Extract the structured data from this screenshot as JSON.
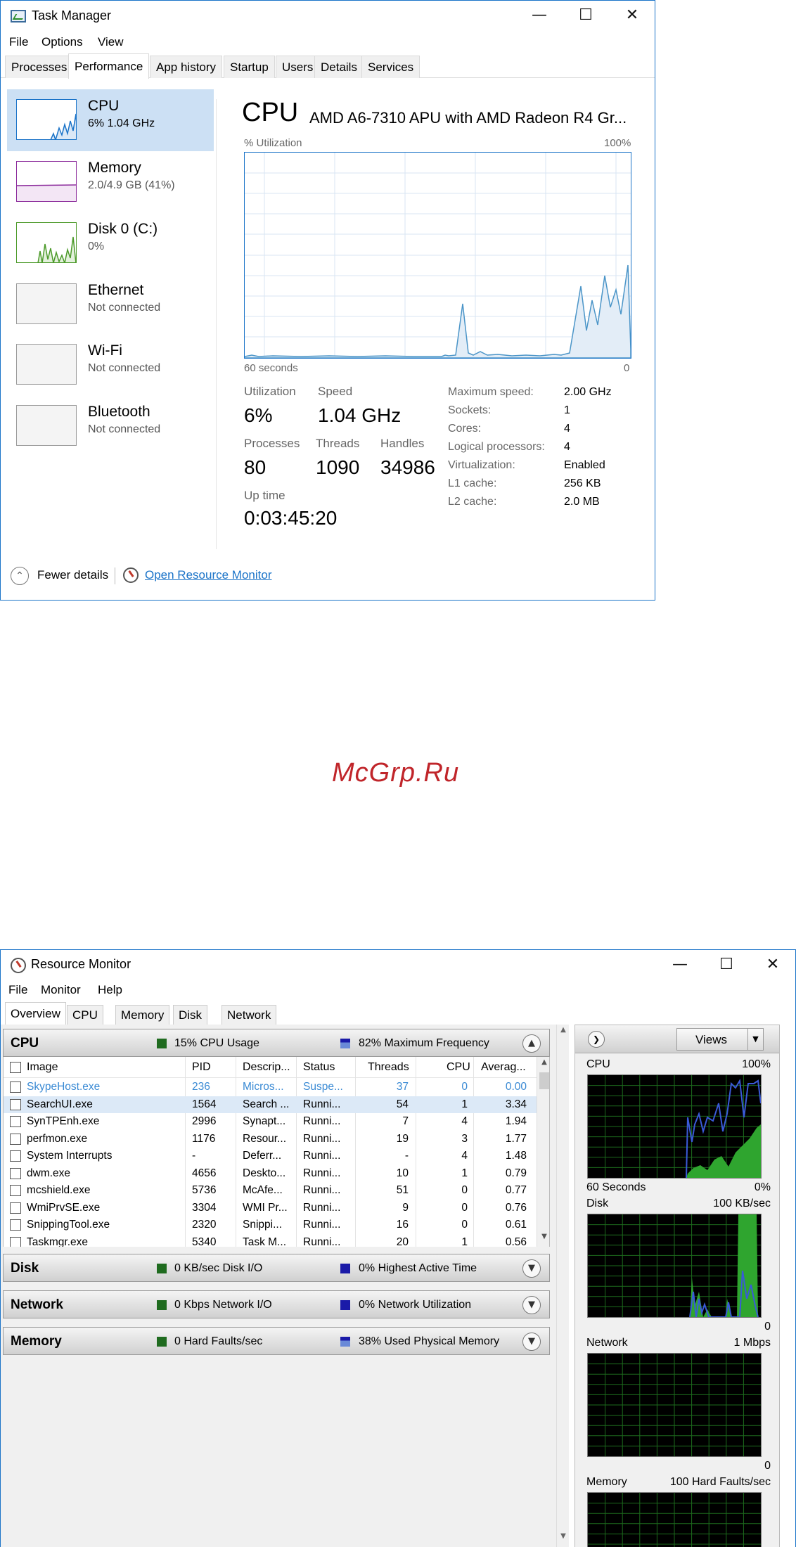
{
  "task_manager": {
    "title": "Task Manager",
    "window_controls": {
      "minimize": "—",
      "maximize": "☐",
      "close": "✕"
    },
    "menu": [
      "File",
      "Options",
      "View"
    ],
    "tabs": [
      "Processes",
      "Performance",
      "App history",
      "Startup",
      "Users",
      "Details",
      "Services"
    ],
    "active_tab": "Performance",
    "sidebar": [
      {
        "name": "CPU",
        "sub": "6%  1.04 GHz",
        "color": "#1a73c8"
      },
      {
        "name": "Memory",
        "sub": "2.0/4.9 GB (41%)",
        "color": "#8b2a9b"
      },
      {
        "name": "Disk 0 (C:)",
        "sub": "0%",
        "color": "#4c9a2a"
      },
      {
        "name": "Ethernet",
        "sub": "Not connected",
        "color": "#999999"
      },
      {
        "name": "Wi-Fi",
        "sub": "Not connected",
        "color": "#999999"
      },
      {
        "name": "Bluetooth",
        "sub": "Not connected",
        "color": "#999999"
      }
    ],
    "cpu": {
      "header": "CPU",
      "model": "AMD A6-7310 APU with AMD Radeon R4 Gr...",
      "util_label": "% Utilization",
      "util_max": "100%",
      "graph_left": "60 seconds",
      "graph_right": "0",
      "utilization_label": "Utilization",
      "utilization": "6%",
      "speed_label": "Speed",
      "speed": "1.04 GHz",
      "processes_label": "Processes",
      "processes": "80",
      "threads_label": "Threads",
      "threads": "1090",
      "handles_label": "Handles",
      "handles": "34986",
      "uptime_label": "Up time",
      "uptime": "0:03:45:20",
      "specs": [
        {
          "label": "Maximum speed:",
          "value": "2.00 GHz"
        },
        {
          "label": "Sockets:",
          "value": "1"
        },
        {
          "label": "Cores:",
          "value": "4"
        },
        {
          "label": "Logical processors:",
          "value": "4"
        },
        {
          "label": "Virtualization:",
          "value": "Enabled"
        },
        {
          "label": "L1 cache:",
          "value": "256 KB"
        },
        {
          "label": "L2 cache:",
          "value": "2.0 MB"
        }
      ]
    },
    "footer": {
      "fewer": "Fewer details",
      "open_rm": "Open Resource Monitor"
    }
  },
  "watermark": "McGrp.Ru",
  "resource_monitor": {
    "title": "Resource Monitor",
    "window_controls": {
      "minimize": "—",
      "maximize": "☐",
      "close": "✕"
    },
    "menu": [
      "File",
      "Monitor",
      "Help"
    ],
    "tabs": [
      "Overview",
      "CPU",
      "Memory",
      "Disk",
      "Network"
    ],
    "active_tab": "Overview",
    "sections": {
      "cpu": {
        "name": "CPU",
        "stat1": "15% CPU Usage",
        "stat2": "82% Maximum Frequency"
      },
      "disk": {
        "name": "Disk",
        "stat1": "0 KB/sec Disk I/O",
        "stat2": "0% Highest Active Time"
      },
      "network": {
        "name": "Network",
        "stat1": "0 Kbps Network I/O",
        "stat2": "0% Network Utilization"
      },
      "memory": {
        "name": "Memory",
        "stat1": "0 Hard Faults/sec",
        "stat2": "38% Used Physical Memory"
      }
    },
    "colors": {
      "green": "#1f6b1f",
      "blue": "#1a1aa8"
    },
    "columns": [
      "Image",
      "PID",
      "Descrip...",
      "Status",
      "Threads",
      "CPU",
      "Averag..."
    ],
    "rows": [
      {
        "image": "SkypeHost.exe",
        "pid": "236",
        "desc": "Micros...",
        "status": "Suspe...",
        "threads": "37",
        "cpu": "0",
        "avg": "0.00"
      },
      {
        "image": "SearchUI.exe",
        "pid": "1564",
        "desc": "Search ...",
        "status": "Runni...",
        "threads": "54",
        "cpu": "1",
        "avg": "3.34"
      },
      {
        "image": "SynTPEnh.exe",
        "pid": "2996",
        "desc": "Synapt...",
        "status": "Runni...",
        "threads": "7",
        "cpu": "4",
        "avg": "1.94"
      },
      {
        "image": "perfmon.exe",
        "pid": "1176",
        "desc": "Resour...",
        "status": "Runni...",
        "threads": "19",
        "cpu": "3",
        "avg": "1.77"
      },
      {
        "image": "System Interrupts",
        "pid": "-",
        "desc": "Deferr...",
        "status": "Runni...",
        "threads": "-",
        "cpu": "4",
        "avg": "1.48"
      },
      {
        "image": "dwm.exe",
        "pid": "4656",
        "desc": "Deskto...",
        "status": "Runni...",
        "threads": "10",
        "cpu": "1",
        "avg": "0.79"
      },
      {
        "image": "mcshield.exe",
        "pid": "5736",
        "desc": "McAfe...",
        "status": "Runni...",
        "threads": "51",
        "cpu": "0",
        "avg": "0.77"
      },
      {
        "image": "WmiPrvSE.exe",
        "pid": "3304",
        "desc": "WMI Pr...",
        "status": "Runni...",
        "threads": "9",
        "cpu": "0",
        "avg": "0.76"
      },
      {
        "image": "SnippingTool.exe",
        "pid": "2320",
        "desc": "Snippi...",
        "status": "Runni...",
        "threads": "16",
        "cpu": "0",
        "avg": "0.61"
      },
      {
        "image": "Taskmgr.exe",
        "pid": "5340",
        "desc": "Task M...",
        "status": "Runni...",
        "threads": "20",
        "cpu": "1",
        "avg": "0.56"
      }
    ],
    "right_panel": {
      "views": "Views",
      "graphs": [
        {
          "name": "CPU",
          "max": "100%",
          "bottom_left": "60 Seconds",
          "bottom_right": "0%"
        },
        {
          "name": "Disk",
          "max": "100 KB/sec",
          "bottom_left": "",
          "bottom_right": "0"
        },
        {
          "name": "Network",
          "max": "1 Mbps",
          "bottom_left": "",
          "bottom_right": "0"
        },
        {
          "name": "Memory",
          "max": "100 Hard Faults/sec",
          "bottom_left": "",
          "bottom_right": ""
        }
      ]
    }
  }
}
